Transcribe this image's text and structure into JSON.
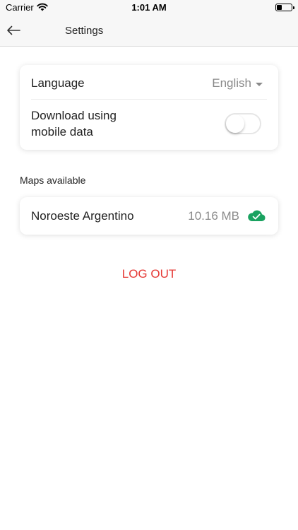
{
  "status_bar": {
    "carrier": "Carrier",
    "time": "1:01 AM",
    "battery_level": 0.35
  },
  "nav": {
    "title": "Settings",
    "back_icon": "arrow-left-icon"
  },
  "settings": {
    "language_label": "Language",
    "language_value": "English",
    "download_label": "Download using mobile data",
    "download_enabled": false
  },
  "maps": {
    "section_title": "Maps available",
    "items": [
      {
        "name": "Noroeste Argentino",
        "size": "10.16 MB",
        "status_icon": "cloud-check-icon"
      }
    ]
  },
  "actions": {
    "logout_label": "LOG OUT"
  },
  "colors": {
    "accent_red": "#e53935",
    "cloud_green": "#1aa260",
    "muted_text": "#8a8a8a",
    "bar_background": "#f7f7f7"
  }
}
